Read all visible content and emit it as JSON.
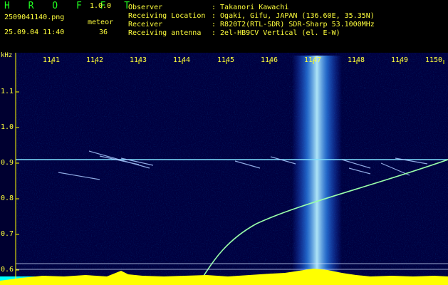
{
  "app": {
    "name": "H R O F F T",
    "version": "1.0.0"
  },
  "capture": {
    "filename": "2509041140.png",
    "datetime": "25.09.04 11:40",
    "meteor_label": "meteor",
    "meteor_count": "36"
  },
  "station": [
    {
      "label": "Observer",
      "value": ": Takanori Kawachi"
    },
    {
      "label": "Receiving Location",
      "value": ": Ogaki, Gifu, JAPAN (136.60E, 35.35N)"
    },
    {
      "label": "Receiver",
      "value": ": R820T2(RTL-SDR) SDR-Sharp 53.1000MHz"
    },
    {
      "label": "Receiving antenna",
      "value": ": 2el-HB9CV Vertical (el. E-W)"
    }
  ],
  "spectrogram": {
    "y_unit": "kHz",
    "x_ticks": [
      "1141",
      "1142",
      "1143",
      "1144",
      "1145",
      "1146",
      "1147",
      "1148",
      "1149",
      "1150"
    ],
    "y_ticks": [
      "1.1",
      "1.0",
      "0.9",
      "0.8",
      "0.7",
      "0.6"
    ],
    "colors": {
      "background": "#000040",
      "label_green": "#22ff22",
      "label_yellow": "#ffff3c",
      "tick_yellow": "#ffff00",
      "trace": "#99ffaa",
      "level_bar": "#ffff00",
      "floor": "#00ffff"
    }
  }
}
